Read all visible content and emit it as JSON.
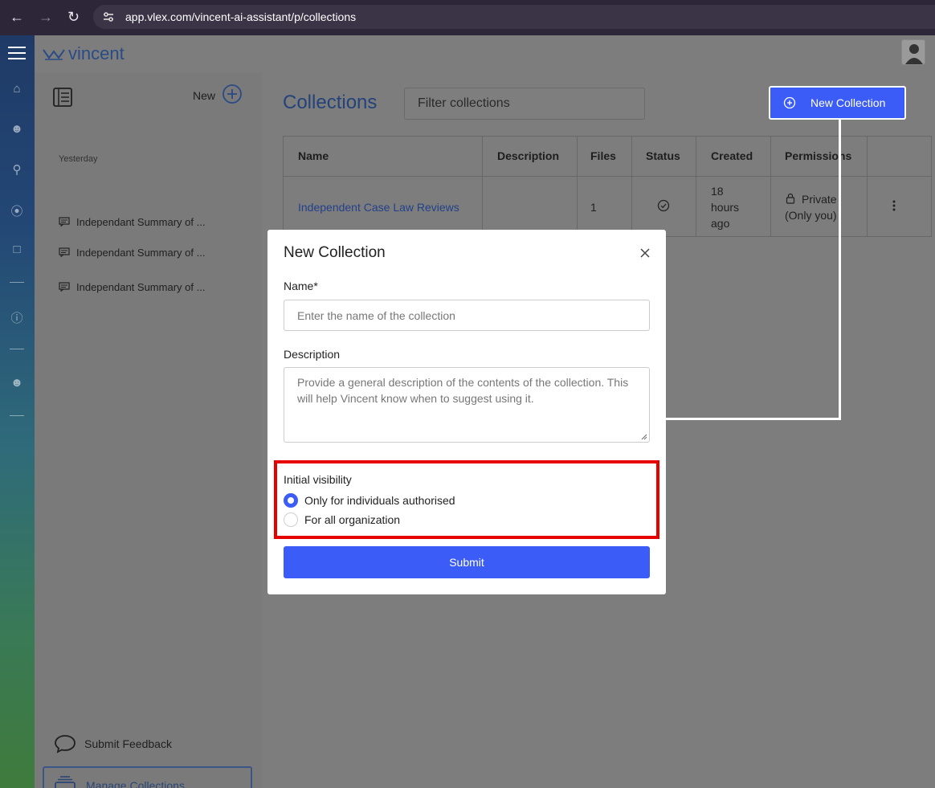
{
  "browser": {
    "url": "app.vlex.com/vincent-ai-assistant/p/collections"
  },
  "app": {
    "logo_text": "vincent"
  },
  "sidebar": {
    "new_label": "New",
    "group_label": "Yesterday",
    "items": [
      {
        "label": "Independant Summary of ..."
      },
      {
        "label": "Independant Summary of ..."
      },
      {
        "label": "Independant Summary of ..."
      }
    ],
    "feedback_label": "Submit Feedback",
    "manage_label": "Manage Collections"
  },
  "main": {
    "title": "Collections",
    "filter_placeholder": "Filter collections",
    "new_collection_label": "New Collection",
    "table": {
      "headers": [
        "Name",
        "Description",
        "Files",
        "Status",
        "Created",
        "Permissions"
      ],
      "rows": [
        {
          "name": "Independent Case Law Reviews",
          "description": "",
          "files": "1",
          "status": "check-circle-icon",
          "created_lines": [
            "18",
            "hours",
            "ago"
          ],
          "permission_lines": [
            "Private",
            "(Only you)"
          ]
        }
      ]
    }
  },
  "modal": {
    "title": "New Collection",
    "name_label": "Name*",
    "name_placeholder": "Enter the name of the collection",
    "description_label": "Description",
    "description_placeholder": "Provide a general description of the contents of the collection. This will help Vincent know when to suggest using it.",
    "visibility_label": "Initial visibility",
    "options": [
      {
        "label": "Only for individuals authorised",
        "selected": true
      },
      {
        "label": "For all organization",
        "selected": false
      }
    ],
    "submit_label": "Submit"
  },
  "colors": {
    "accent": "#3b5cf6",
    "highlight": "#e60000",
    "brand": "#23437a"
  }
}
